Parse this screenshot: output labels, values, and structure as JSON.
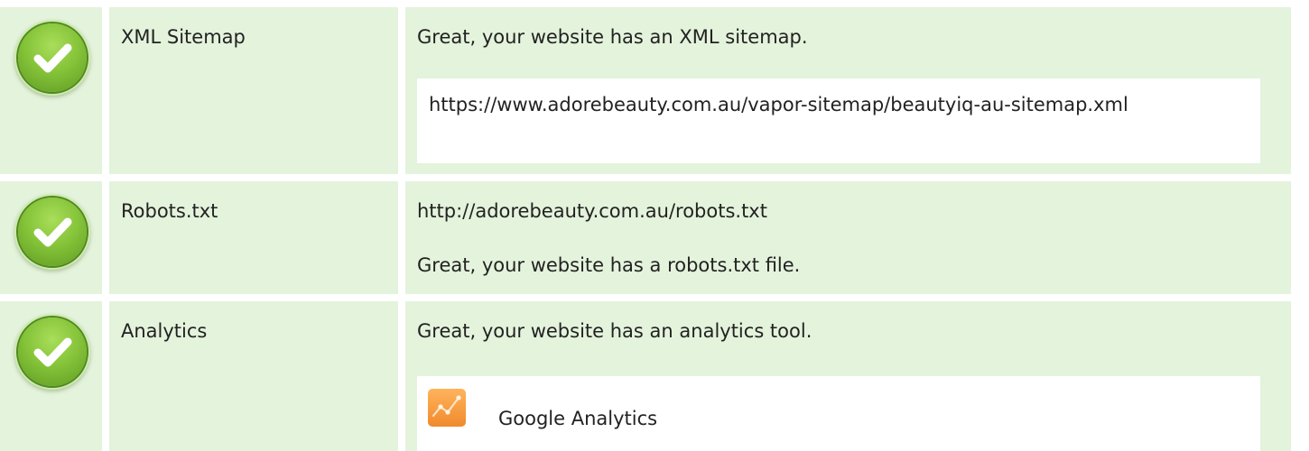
{
  "rows": [
    {
      "name": "XML Sitemap",
      "status_icon": "check-icon",
      "detail_line": "Great, your website has an XML sitemap.",
      "detail_box": "https://www.adorebeauty.com.au/vapor-sitemap/beautyiq-au-sitemap.xml"
    },
    {
      "name": "Robots.txt",
      "status_icon": "check-icon",
      "detail_line": "http://adorebeauty.com.au/robots.txt",
      "detail_line_2": "Great, your website has a robots.txt file."
    },
    {
      "name": "Analytics",
      "status_icon": "check-icon",
      "detail_line": "Great, your website has an analytics tool.",
      "tool": {
        "label": "Google Analytics",
        "icon": "google-analytics-icon"
      }
    }
  ],
  "colors": {
    "row_background": "#e4f3dc",
    "box_background": "#ffffff",
    "check_green": "#86c43a",
    "analytics_orange": "#f59a3a"
  }
}
